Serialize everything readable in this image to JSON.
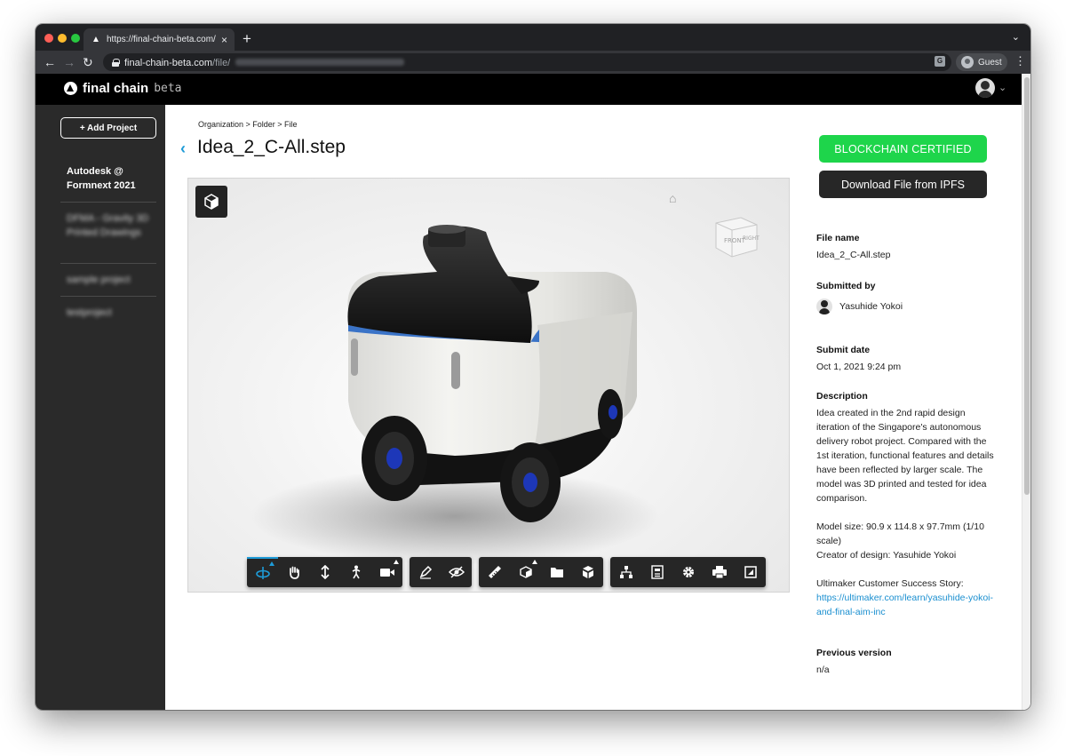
{
  "browser": {
    "tab_title": "https://final-chain-beta.com/fil",
    "url_host": "final-chain-beta.com",
    "url_path": "/file/",
    "profile_label": "Guest"
  },
  "app": {
    "brand": "final chain",
    "brand_suffix": "beta"
  },
  "sidebar": {
    "add_project_label": "+ Add Project",
    "items": [
      {
        "label": "Autodesk @ Formnext 2021"
      },
      {
        "label": "DFMA - Gravity 3D Printed Drawings"
      },
      {
        "label": "sample project"
      },
      {
        "label": "testproject"
      }
    ]
  },
  "breadcrumb": "Organization > Folder > File",
  "title": "Idea_2_C-All.step",
  "viewer": {
    "viewcube_front": "FRONT",
    "viewcube_right": "RIGHT",
    "tools": [
      [
        "orbit-icon",
        "pan-icon",
        "zoom-icon",
        "first-person-icon",
        "camera-icon"
      ],
      [
        "markup-icon",
        "hide-icon"
      ],
      [
        "measure-icon",
        "explode-icon",
        "model-browser-icon",
        "section-icon"
      ],
      [
        "structure-icon",
        "properties-icon",
        "settings-icon",
        "print-icon",
        "fullscreen-icon"
      ]
    ]
  },
  "actions": {
    "certified_label": "BLOCKCHAIN CERTIFIED",
    "download_label": "Download File from IPFS"
  },
  "details": {
    "file_name_label": "File name",
    "file_name": "Idea_2_C-All.step",
    "submitted_by_label": "Submitted by",
    "submitted_by": "Yasuhide Yokoi",
    "submit_date_label": "Submit date",
    "submit_date": "Oct 1, 2021 9:24 pm",
    "description_label": "Description",
    "description": "Idea created in the 2nd rapid design iteration of the Singapore's autonomous delivery robot project. Compared with the 1st iteration, functional features and details have been reflected by larger scale. The model was 3D printed and tested for idea comparison.",
    "model_size": "Model size: 90.9 x 114.8 x 97.7mm (1/10 scale)",
    "creator": "Creator of design: Yasuhide Yokoi",
    "story_label": "Ultimaker Customer Success Story:",
    "story_link": "https://ultimaker.com/learn/yasuhide-yokoi-and-final-aim-inc",
    "previous_version_label": "Previous version",
    "previous_version": "n/a"
  },
  "colors": {
    "accent_green": "#1ed54b",
    "accent_blue": "#1e9bd7",
    "sidebar_bg": "#2a2a2a"
  }
}
